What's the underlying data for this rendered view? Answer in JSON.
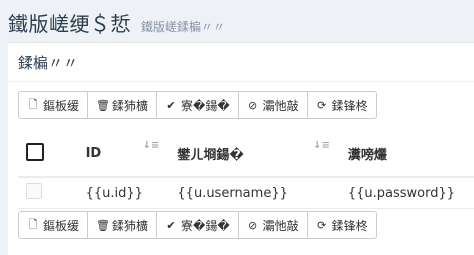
{
  "header": {
    "title": "鐵版嵯绠＄悊",
    "subtitle": "鐵版嵯鍒楄〃〃"
  },
  "portlet": {
    "title": "鍒楄〃〃"
  },
  "toolbar": {
    "add_label": "鏂板缓",
    "delete_label": "鍒犻櫎",
    "confirm_label": "寮�鍚�",
    "disable_label": "灞忚敲",
    "refresh_label": "鍒锋柊"
  },
  "table": {
    "headers": {
      "id": "ID",
      "username": "鐢ㄦ埛鍚�",
      "password": "瀵嗙爜"
    },
    "rows": [
      {
        "id": "{{u.id}}",
        "username": "{{u.username}}",
        "password": "{{u.password}}"
      }
    ]
  }
}
